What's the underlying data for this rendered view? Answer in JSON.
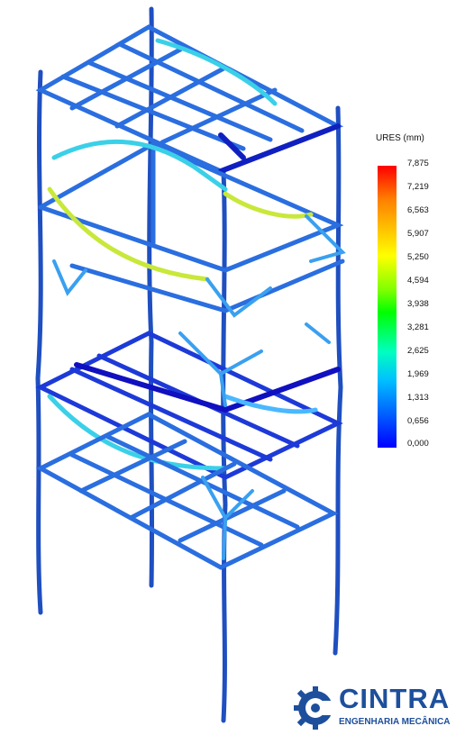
{
  "legend": {
    "title": "URES (mm)",
    "ticks": [
      "7,875",
      "7,219",
      "6,563",
      "5,907",
      "5,250",
      "4,594",
      "3,938",
      "3,281",
      "2,625",
      "1,969",
      "1,313",
      "0,656",
      "0,000"
    ],
    "colors": {
      "max": "#ff0000",
      "mid": "#ffff00",
      "low": "#00ffff",
      "min": "#0000ff"
    }
  },
  "brand": {
    "name": "CINTRA",
    "subtitle": "ENGENHARIA MECÂNICA",
    "color": "#1d4f9c"
  },
  "model": {
    "frame_color": "#1f5fd0",
    "highlight_colors": [
      "#3ad0e8",
      "#c8e83a",
      "#4ab8ff",
      "#0000c8"
    ]
  }
}
